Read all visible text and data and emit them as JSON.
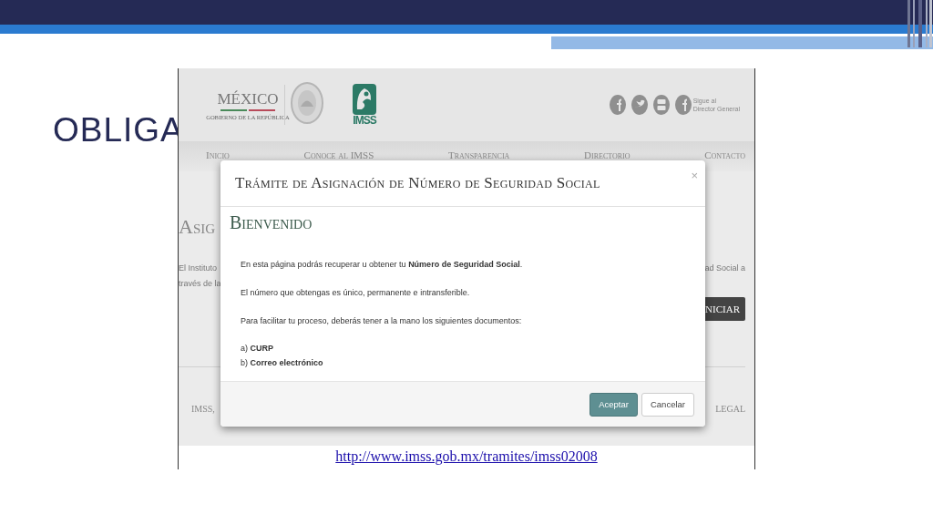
{
  "slide": {
    "title": "OBLIGA"
  },
  "web_page": {
    "header": {
      "brand": "MÉXICO",
      "brand_subtitle": "GOBIERNO DE LA REPÚBLICA",
      "logo_text": "IMSS",
      "follow_text": [
        "Sigue al",
        "Director General"
      ]
    },
    "nav": [
      "Inicio",
      "Conoce al IMSS",
      "Transparencia",
      "Directorio",
      "Contacto"
    ],
    "heading": "Asig",
    "intro_left": [
      "El Instituto",
      "través de la"
    ],
    "intro_right": "ad Social a",
    "start_button": "NICIAR",
    "footer_left": "IMSS,",
    "footer_right": "LEGAL",
    "link": "http://www.imss.gob.mx/tramites/imss02008"
  },
  "dialog": {
    "title": "Trámite de Asignación de Número de Seguridad Social",
    "close": "×",
    "heading": "Bienvenido",
    "paragraphs": [
      "En esta página podrás recuperar u obtener tu **Número de Seguridad Social**.",
      "El número que obtengas es único, permanente e intransferible.",
      "Para facilitar tu proceso, deberás tener a la mano los siguientes documentos:"
    ],
    "documents": [
      "a) **CURP**",
      "b) **Correo electrónico**"
    ],
    "buttons": [
      {
        "label": "Aceptar",
        "kind": "primary"
      },
      {
        "label": "Cancelar",
        "kind": "default"
      }
    ]
  }
}
